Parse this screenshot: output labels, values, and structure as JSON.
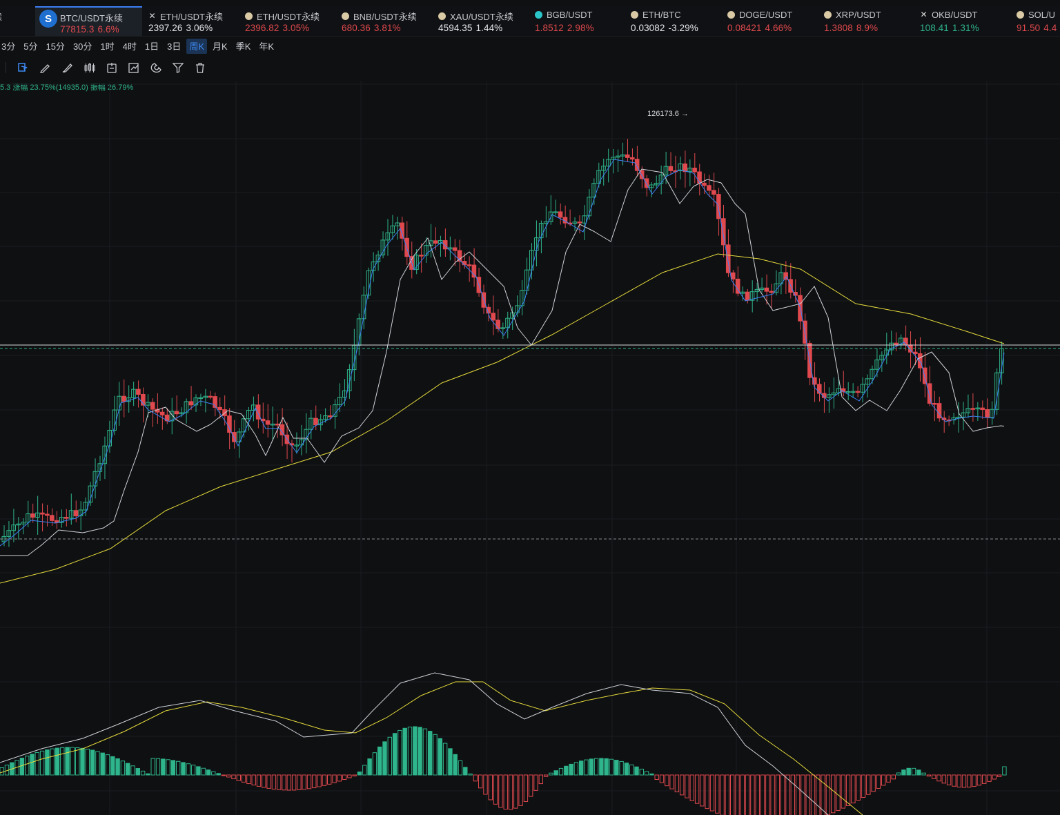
{
  "tickers": [
    {
      "name": "T永续",
      "price": "",
      "change": "%",
      "color": "red",
      "icon": "coin-icon"
    },
    {
      "name": "BTC/USDT永续",
      "price": "77815.3",
      "change": "6.6%",
      "color": "red",
      "icon": "btc-icon",
      "active": true
    },
    {
      "name": "ETH/USDT永续",
      "price": "2397.26",
      "change": "3.06%",
      "color": "wht",
      "icon": "close-icon"
    },
    {
      "name": "ETH/USDT永续",
      "price": "2396.82",
      "change": "3.05%",
      "color": "red",
      "icon": "coin-icon"
    },
    {
      "name": "BNB/USDT永续",
      "price": "680.36",
      "change": "3.81%",
      "color": "red",
      "icon": "coin-icon"
    },
    {
      "name": "XAU/USDT永续",
      "price": "4594.35",
      "change": "1.44%",
      "color": "wht",
      "icon": "coin-icon"
    },
    {
      "name": "BGB/USDT",
      "price": "1.8512",
      "change": "2.98%",
      "color": "red",
      "icon": "bgb-icon"
    },
    {
      "name": "ETH/BTC",
      "price": "0.03082",
      "change": "-3.29%",
      "color": "wht",
      "icon": "coin-icon"
    },
    {
      "name": "DOGE/USDT",
      "price": "0.08421",
      "change": "4.66%",
      "color": "red",
      "icon": "coin-icon"
    },
    {
      "name": "XRP/USDT",
      "price": "1.3808",
      "change": "8.9%",
      "color": "red",
      "icon": "coin-icon"
    },
    {
      "name": "OKB/USDT",
      "price": "108.41",
      "change": "1.31%",
      "color": "grn",
      "icon": "close-icon"
    },
    {
      "name": "SOL/U",
      "price": "91.50",
      "change": "4.4",
      "color": "red",
      "icon": "coin-icon"
    }
  ],
  "intervals": [
    "3分",
    "5分",
    "15分",
    "30分",
    "1时",
    "4时",
    "1日",
    "3日",
    "周K",
    "月K",
    "季K",
    "年K"
  ],
  "selected_interval": "周K",
  "tools": [
    "select-icon",
    "pencil-icon",
    "brush-icon",
    "candle-icon",
    "clock-icon",
    "edit-icon",
    "magnet-icon",
    "filter-icon",
    "trash-icon"
  ],
  "info_text": "5.3  涨幅 23.75%(14935.0)  振幅 26.79%",
  "high_label": "126173.6 →",
  "colors": {
    "up": "#2eb58b",
    "down": "#e0494e",
    "ma_fast": "#3b82f6",
    "ma_mid": "#cfd3d8",
    "ma_slow": "#e6db3c",
    "dif": "#cfd3d8",
    "dea": "#e6db3c"
  }
}
